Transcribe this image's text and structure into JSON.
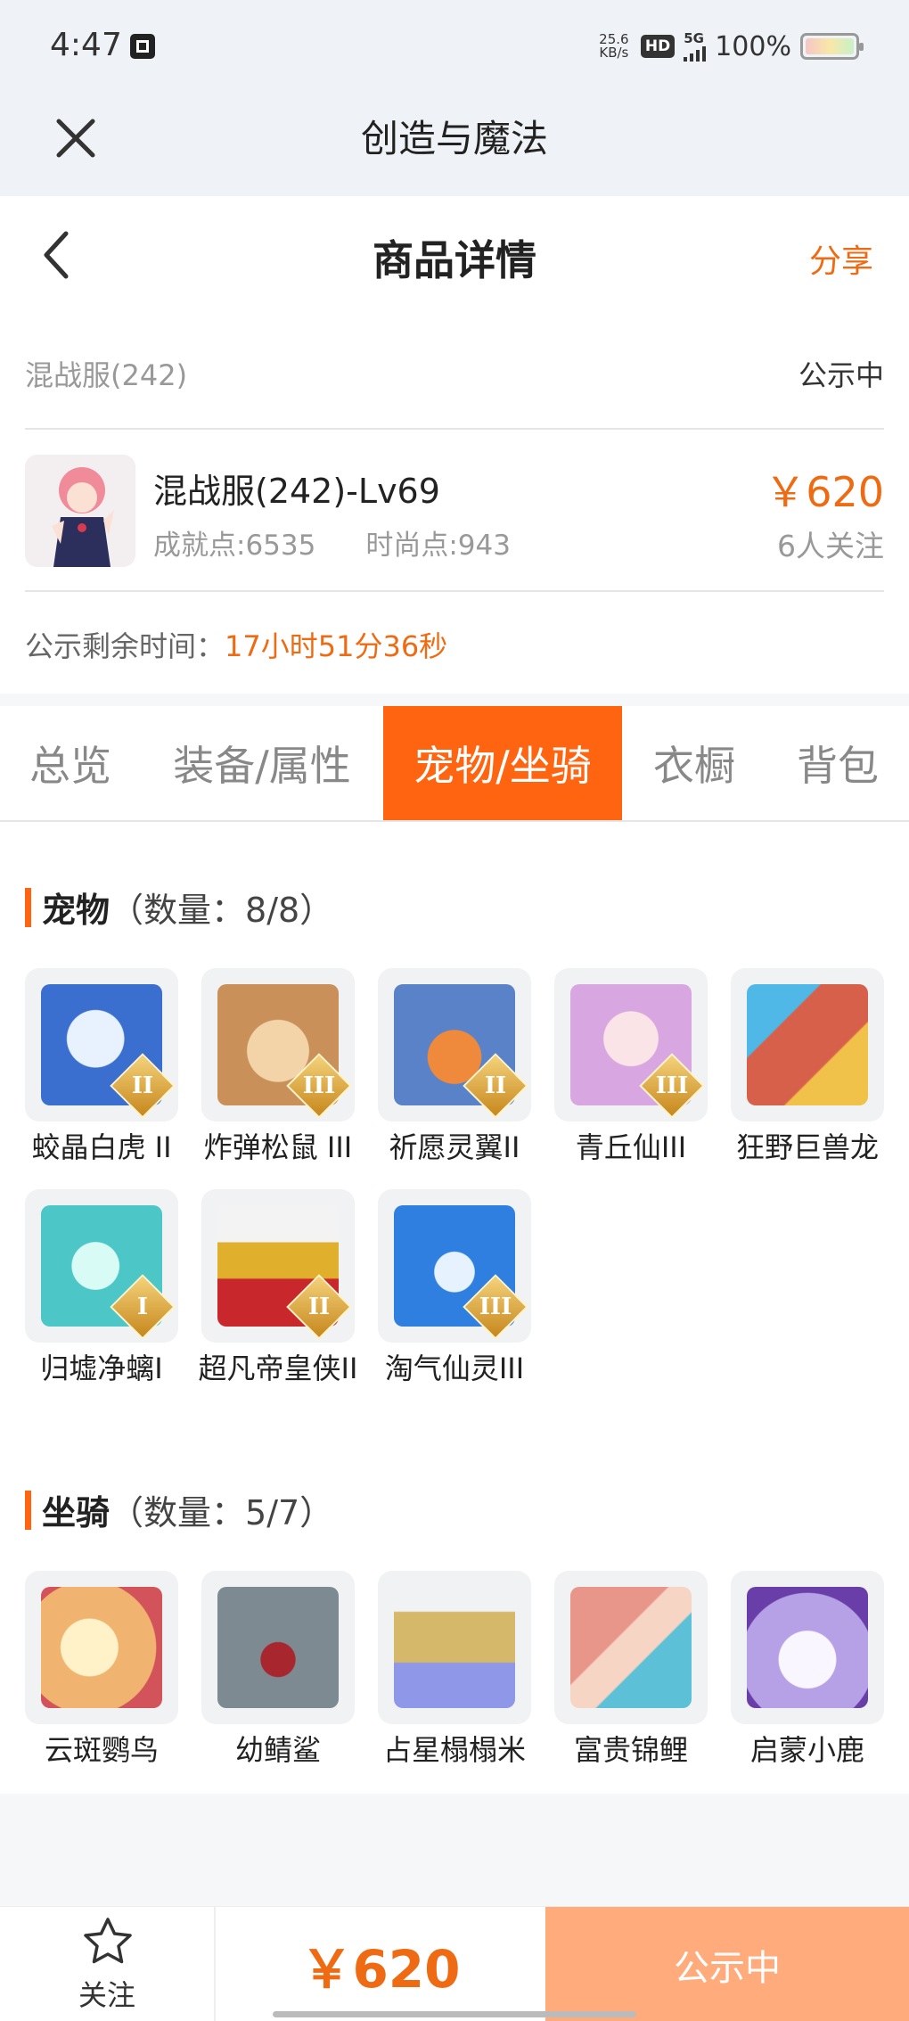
{
  "status_bar": {
    "time": "4:47",
    "net_speed_value": "25.6",
    "net_speed_unit": "KB/s",
    "hd": "HD",
    "network": "5G",
    "battery": "100%"
  },
  "app_bar": {
    "title": "创造与魔法",
    "close_icon": "close-icon"
  },
  "detail_header": {
    "title": "商品详情",
    "share": "分享",
    "back_icon": "back-icon"
  },
  "listing": {
    "server": "混战服(242)",
    "status": "公示中",
    "character_name": "混战服(242)-Lv69",
    "achievement": "成就点:6535",
    "fashion": "时尚点:943",
    "price": "￥620",
    "followers": "6人关注",
    "remaining_label": "公示剩余时间：",
    "remaining_value": "17小时51分36秒"
  },
  "tabs": [
    {
      "label": "总览",
      "active": false
    },
    {
      "label": "装备/属性",
      "active": false
    },
    {
      "label": "宠物/坐骑",
      "active": true
    },
    {
      "label": "衣橱",
      "active": false
    },
    {
      "label": "背包",
      "active": false
    }
  ],
  "pets": {
    "title": "宠物",
    "count": "（数量：8/8）",
    "items": [
      {
        "name": "蛟晶白虎 II",
        "rank": "II",
        "color": "#3a6fd0"
      },
      {
        "name": "炸弹松鼠 III",
        "rank": "III",
        "color": "#c9905a"
      },
      {
        "name": "祈愿灵翼II",
        "rank": "II",
        "color": "#5a82c8"
      },
      {
        "name": "青丘仙III",
        "rank": "III",
        "color": "#d8a6e0"
      },
      {
        "name": "狂野巨兽龙",
        "rank": "",
        "color": "#d6604a"
      },
      {
        "name": "归墟净螭I",
        "rank": "I",
        "color": "#4cc6c6"
      },
      {
        "name": "超凡帝皇侠II",
        "rank": "II",
        "color": "#e0b02c"
      },
      {
        "name": "淘气仙灵III",
        "rank": "III",
        "color": "#2f7fe0"
      }
    ]
  },
  "mounts": {
    "title": "坐骑",
    "count": "（数量：5/7）",
    "items": [
      {
        "name": "云斑鹦鸟",
        "color": "#f0b470"
      },
      {
        "name": "幼鲭鲨",
        "color": "#7d8a92"
      },
      {
        "name": "占星榻榻米",
        "color": "#d6b86a"
      },
      {
        "name": "富贵锦鲤",
        "color": "#e8958a"
      },
      {
        "name": "启蒙小鹿",
        "color": "#b6a0e6"
      }
    ]
  },
  "bottom_bar": {
    "follow": "关注",
    "price": "￥620",
    "action": "公示中"
  }
}
